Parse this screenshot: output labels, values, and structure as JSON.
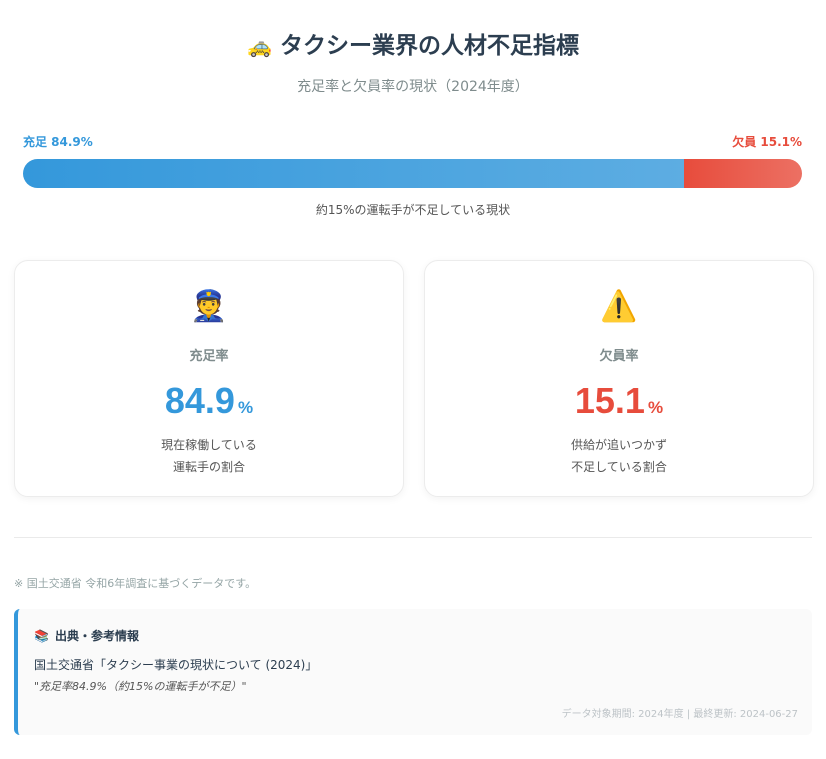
{
  "header": {
    "icon": "🚕",
    "title": "タクシー業界の人材不足指標",
    "subtitle": "充足率と欠員率の現状（2024年度）"
  },
  "bar": {
    "fill_label": "充足 84.9%",
    "short_label": "欠員 15.1%",
    "fill_percent": 84.9,
    "short_percent": 15.1,
    "note": "約15%の運転手が不足している現状",
    "colors": {
      "fill": "#3498db",
      "short": "#e74c3c"
    }
  },
  "cards": {
    "fill": {
      "icon": "👮",
      "label": "充足率",
      "value": "84.9",
      "unit": "%",
      "desc_line1": "現在稼働している",
      "desc_line2": "運転手の割合"
    },
    "short": {
      "icon": "⚠️",
      "label": "欠員率",
      "value": "15.1",
      "unit": "%",
      "desc_line1": "供給が追いつかず",
      "desc_line2": "不足している割合"
    }
  },
  "footnote": "※ 国土交通省 令和6年調査に基づくデータです。",
  "source": {
    "icon": "📚",
    "title": "出典・参考情報",
    "line1": "国土交通省「タクシー事業の現状について (2024)」",
    "line2": "\"充足率84.9%（約15%の運転手が不足）\"",
    "meta": "データ対象期間: 2024年度 | 最終更新: 2024-06-27"
  }
}
